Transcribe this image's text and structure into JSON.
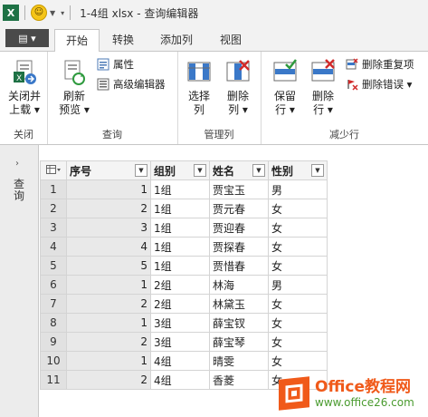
{
  "titlebar": {
    "title": "1-4组 xlsx - 查询编辑器",
    "app_icon_letter": "X",
    "smiley": "☺"
  },
  "tabs": {
    "file_label": "▤ ▾",
    "items": [
      "开始",
      "转换",
      "添加列",
      "视图"
    ]
  },
  "ribbon": {
    "groups": {
      "close": {
        "label": "关闭",
        "close_load": "关闭并\n上载 ▾"
      },
      "query": {
        "label": "查询",
        "refresh": "刷新\n预览 ▾",
        "properties": "属性",
        "advanced_editor": "高级编辑器"
      },
      "manage_columns": {
        "label": "管理列",
        "choose_columns": "选择\n列",
        "remove_columns": "删除\n列 ▾"
      },
      "reduce_rows": {
        "label": "减少行",
        "keep_rows": "保留\n行 ▾",
        "remove_rows": "删除\n行 ▾",
        "remove_duplicates": "删除重复项",
        "remove_errors": "删除错误 ▾"
      }
    }
  },
  "left_pane": {
    "label": "查询",
    "chevron": "›"
  },
  "table": {
    "columns": [
      "序号",
      "组别",
      "姓名",
      "性别"
    ],
    "rows": [
      {
        "n": "1",
        "seq": "1",
        "group": "1组",
        "name": "贾宝玉",
        "gender": "男"
      },
      {
        "n": "2",
        "seq": "2",
        "group": "1组",
        "name": "贾元春",
        "gender": "女"
      },
      {
        "n": "3",
        "seq": "3",
        "group": "1组",
        "name": "贾迎春",
        "gender": "女"
      },
      {
        "n": "4",
        "seq": "4",
        "group": "1组",
        "name": "贾探春",
        "gender": "女"
      },
      {
        "n": "5",
        "seq": "5",
        "group": "1组",
        "name": "贾惜春",
        "gender": "女"
      },
      {
        "n": "6",
        "seq": "1",
        "group": "2组",
        "name": "林海",
        "gender": "男"
      },
      {
        "n": "7",
        "seq": "2",
        "group": "2组",
        "name": "林黛玉",
        "gender": "女"
      },
      {
        "n": "8",
        "seq": "1",
        "group": "3组",
        "name": "薛宝钗",
        "gender": "女"
      },
      {
        "n": "9",
        "seq": "2",
        "group": "3组",
        "name": "薛宝琴",
        "gender": "女"
      },
      {
        "n": "10",
        "seq": "1",
        "group": "4组",
        "name": "晴雯",
        "gender": "女"
      },
      {
        "n": "11",
        "seq": "2",
        "group": "4组",
        "name": "香菱",
        "gender": "女"
      }
    ]
  },
  "watermark": {
    "line1": "Office教程网",
    "line2": "www.office26.com"
  },
  "colors": {
    "excel_green": "#1e7145",
    "selected_col": "#e9e9e9",
    "watermark_orange": "#f05a1a",
    "watermark_green": "#4a9b2f"
  }
}
